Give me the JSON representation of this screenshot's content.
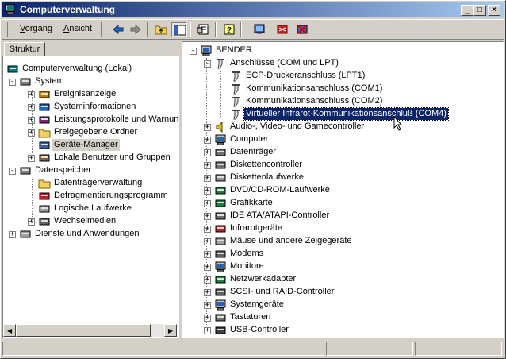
{
  "window": {
    "title": "Computerverwaltung"
  },
  "toolbar": {
    "action": "Vorgang",
    "action_key": "V",
    "view": "Ansicht",
    "view_key": "A"
  },
  "left": {
    "tab": "Struktur",
    "tree": [
      {
        "label": "Computerverwaltung (Lokal)",
        "icon": "computer-management-icon"
      },
      {
        "label": "System",
        "icon": "system-tools-icon"
      },
      {
        "label": "Ereignisanzeige",
        "icon": "event-viewer-icon"
      },
      {
        "label": "Systeminformationen",
        "icon": "system-info-icon"
      },
      {
        "label": "Leistungsprotokolle und Warnungen",
        "icon": "performance-logs-icon"
      },
      {
        "label": "Freigegebene Ordner",
        "icon": "shared-folders-icon"
      },
      {
        "label": "Geräte-Manager",
        "icon": "device-manager-icon"
      },
      {
        "label": "Lokale Benutzer und Gruppen",
        "icon": "users-groups-icon"
      },
      {
        "label": "Datenspeicher",
        "icon": "storage-icon"
      },
      {
        "label": "Datenträgerverwaltung",
        "icon": "disk-management-icon"
      },
      {
        "label": "Defragmentierungsprogramm",
        "icon": "defrag-icon"
      },
      {
        "label": "Logische Laufwerke",
        "icon": "logical-drives-icon"
      },
      {
        "label": "Wechselmedien",
        "icon": "removable-storage-icon"
      },
      {
        "label": "Dienste und Anwendungen",
        "icon": "services-apps-icon"
      }
    ]
  },
  "right": {
    "tree": [
      {
        "label": "BENDER",
        "icon": "computer-icon"
      },
      {
        "label": "Anschlüsse (COM und LPT)",
        "icon": "port-icon"
      },
      {
        "label": "ECP-Druckeranschluss (LPT1)",
        "icon": "port-icon"
      },
      {
        "label": "Kommunikationsanschluss (COM1)",
        "icon": "port-icon"
      },
      {
        "label": "Kommunikationsanschluss (COM2)",
        "icon": "port-icon"
      },
      {
        "label": "Virtueller Infrarot-Kommunikationsanschluß (COM4)",
        "icon": "port-icon"
      },
      {
        "label": "Audio-, Video- und Gamecontroller",
        "icon": "speaker-icon"
      },
      {
        "label": "Computer",
        "icon": "computer-icon"
      },
      {
        "label": "Datenträger",
        "icon": "disk-icon"
      },
      {
        "label": "Diskettencontroller",
        "icon": "floppy-controller-icon"
      },
      {
        "label": "Diskettenlaufwerke",
        "icon": "floppy-drive-icon"
      },
      {
        "label": "DVD/CD-ROM-Laufwerke",
        "icon": "cdrom-icon"
      },
      {
        "label": "Grafikkarte",
        "icon": "display-adapter-icon"
      },
      {
        "label": "IDE ATA/ATAPI-Controller",
        "icon": "ide-controller-icon"
      },
      {
        "label": "Infrarotgeräte",
        "icon": "infrared-icon"
      },
      {
        "label": "Mäuse und andere Zeigegeräte",
        "icon": "mouse-icon"
      },
      {
        "label": "Modems",
        "icon": "modem-icon"
      },
      {
        "label": "Monitore",
        "icon": "monitor-icon"
      },
      {
        "label": "Netzwerkadapter",
        "icon": "network-adapter-icon"
      },
      {
        "label": "SCSI- und RAID-Controller",
        "icon": "scsi-icon"
      },
      {
        "label": "Systemgeräte",
        "icon": "system-devices-icon"
      },
      {
        "label": "Tastaturen",
        "icon": "keyboard-icon"
      },
      {
        "label": "USB-Controller",
        "icon": "usb-icon"
      }
    ]
  },
  "colors": {
    "title_start": "#0a246a",
    "title_end": "#a6caf0",
    "selection": "#0a246a",
    "face": "#d4d0c8"
  }
}
